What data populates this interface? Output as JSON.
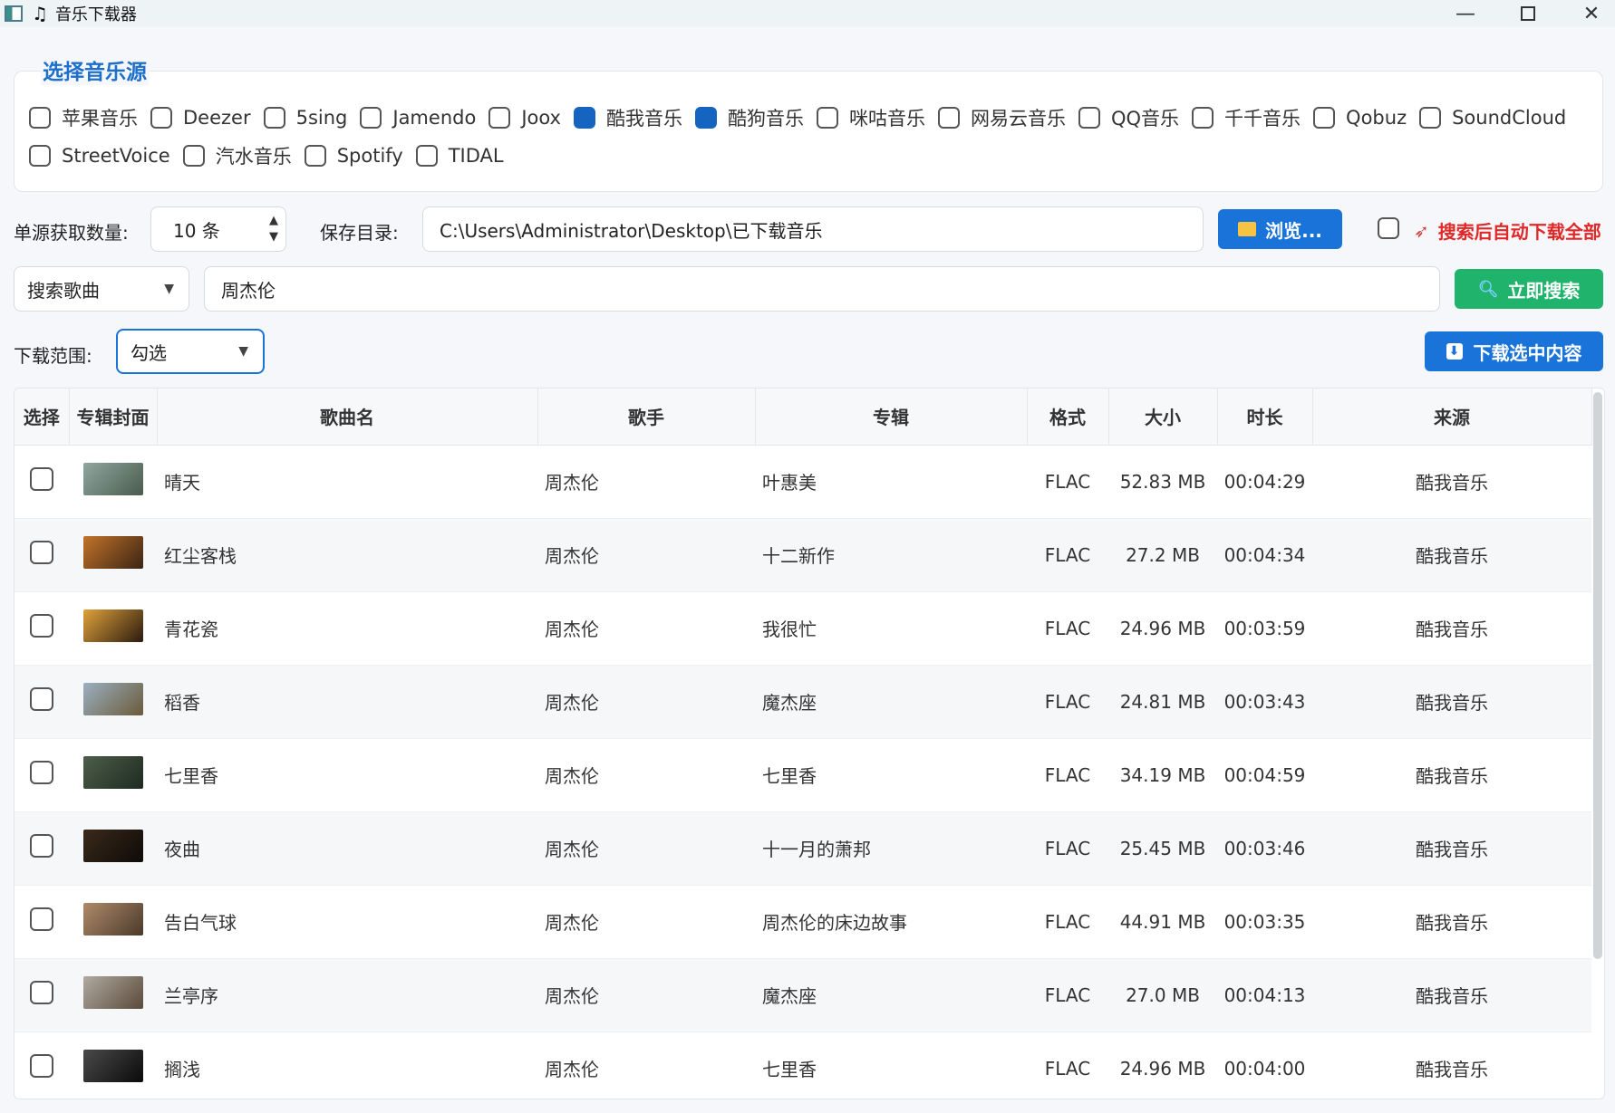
{
  "window": {
    "title": "音乐下载器",
    "min": "—",
    "close": "✕"
  },
  "source_group": {
    "title": "选择音乐源",
    "row1": [
      {
        "label": "苹果音乐",
        "checked": false
      },
      {
        "label": "Deezer",
        "checked": false
      },
      {
        "label": "5sing",
        "checked": false
      },
      {
        "label": "Jamendo",
        "checked": false
      },
      {
        "label": "Joox",
        "checked": false
      },
      {
        "label": "酷我音乐",
        "checked": true
      },
      {
        "label": "酷狗音乐",
        "checked": true
      },
      {
        "label": "咪咕音乐",
        "checked": false
      },
      {
        "label": "网易云音乐",
        "checked": false
      },
      {
        "label": "QQ音乐",
        "checked": false
      },
      {
        "label": "千千音乐",
        "checked": false
      },
      {
        "label": "Qobuz",
        "checked": false
      },
      {
        "label": "SoundCloud",
        "checked": false
      }
    ],
    "row2": [
      {
        "label": "StreetVoice",
        "checked": false
      },
      {
        "label": "汽水音乐",
        "checked": false
      },
      {
        "label": "Spotify",
        "checked": false
      },
      {
        "label": "TIDAL",
        "checked": false
      }
    ]
  },
  "settings": {
    "count_label": "单源获取数量:",
    "count_value": "10 条",
    "dir_label": "保存目录:",
    "dir_value": "C:\\Users\\Administrator\\Desktop\\已下载音乐",
    "browse_label": "浏览...",
    "auto_download_label": "搜索后自动下载全部"
  },
  "search": {
    "mode": "搜索歌曲",
    "query": "周杰伦",
    "button": "立即搜索"
  },
  "download": {
    "range_label": "下载范围:",
    "range_value": "勾选",
    "button": "下载选中内容"
  },
  "table": {
    "headers": [
      "选择",
      "专辑封面",
      "歌曲名",
      "歌手",
      "专辑",
      "格式",
      "大小",
      "时长",
      "来源"
    ],
    "rows": [
      {
        "song": "晴天",
        "artist": "周杰伦",
        "album": "叶惠美",
        "format": "FLAC",
        "size": "52.83 MB",
        "duration": "00:04:29",
        "source": "酷我音乐",
        "cover": [
          "#8fa7a0",
          "#4a5b4d"
        ]
      },
      {
        "song": "红尘客栈",
        "artist": "周杰伦",
        "album": "十二新作",
        "format": "FLAC",
        "size": "27.2 MB",
        "duration": "00:04:34",
        "source": "酷我音乐",
        "cover": [
          "#c2732a",
          "#3a2414"
        ]
      },
      {
        "song": "青花瓷",
        "artist": "周杰伦",
        "album": "我很忙",
        "format": "FLAC",
        "size": "24.96 MB",
        "duration": "00:03:59",
        "source": "酷我音乐",
        "cover": [
          "#e0a23a",
          "#2b1a10"
        ]
      },
      {
        "song": "稻香",
        "artist": "周杰伦",
        "album": "魔杰座",
        "format": "FLAC",
        "size": "24.81 MB",
        "duration": "00:03:43",
        "source": "酷我音乐",
        "cover": [
          "#9ab0c0",
          "#6b5a3a"
        ]
      },
      {
        "song": "七里香",
        "artist": "周杰伦",
        "album": "七里香",
        "format": "FLAC",
        "size": "34.19 MB",
        "duration": "00:04:59",
        "source": "酷我音乐",
        "cover": [
          "#4d5e4a",
          "#1e2a20"
        ]
      },
      {
        "song": "夜曲",
        "artist": "周杰伦",
        "album": "十一月的萧邦",
        "format": "FLAC",
        "size": "25.45 MB",
        "duration": "00:03:46",
        "source": "酷我音乐",
        "cover": [
          "#3a2a1a",
          "#0e0a08"
        ]
      },
      {
        "song": "告白气球",
        "artist": "周杰伦",
        "album": "周杰伦的床边故事",
        "format": "FLAC",
        "size": "44.91 MB",
        "duration": "00:03:35",
        "source": "酷我音乐",
        "cover": [
          "#b08a6a",
          "#4a3a2a"
        ]
      },
      {
        "song": "兰亭序",
        "artist": "周杰伦",
        "album": "魔杰座",
        "format": "FLAC",
        "size": "27.0 MB",
        "duration": "00:04:13",
        "source": "酷我音乐",
        "cover": [
          "#b0aaa0",
          "#5a4a3a"
        ]
      },
      {
        "song": "搁浅",
        "artist": "周杰伦",
        "album": "七里香",
        "format": "FLAC",
        "size": "24.96 MB",
        "duration": "00:04:00",
        "source": "酷我音乐",
        "cover": [
          "#4a4a4a",
          "#0a0a0a"
        ]
      }
    ]
  }
}
